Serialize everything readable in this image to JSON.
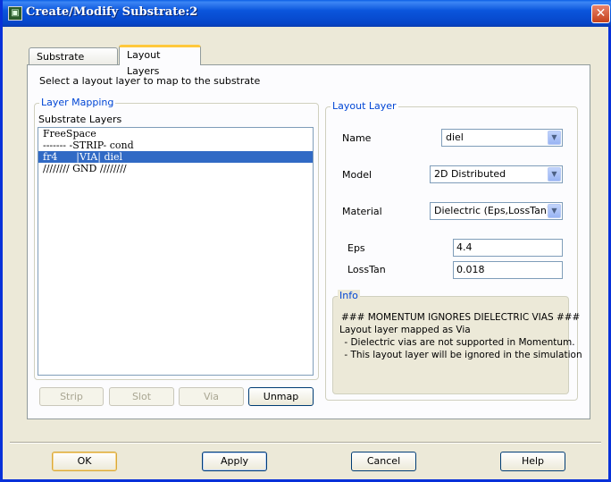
{
  "window": {
    "title": "Create/Modify Substrate:2",
    "close_glyph": "✕",
    "icon": "app-icon"
  },
  "tabs": [
    {
      "label": "Substrate Layers",
      "active": false
    },
    {
      "label": "Layout Layers",
      "active": true
    }
  ],
  "hint": "Select a layout layer to map to the substrate",
  "layer_mapping": {
    "title": "Layer Mapping",
    "list_label": "Substrate Layers",
    "items": [
      {
        "text": "FreeSpace",
        "selected": false
      },
      {
        "text": "------- -STRIP- cond",
        "selected": false
      },
      {
        "text": "fr4      |VIA| diel",
        "selected": true
      },
      {
        "text": "//////// GND ////////",
        "selected": false
      }
    ],
    "buttons": {
      "strip": "Strip",
      "slot": "Slot",
      "via": "Via",
      "unmap": "Unmap"
    }
  },
  "layout_layer": {
    "title": "Layout Layer",
    "name_label": "Name",
    "name_value": "diel",
    "model_label": "Model",
    "model_value": "2D Distributed",
    "material_label": "Material",
    "material_value": "Dielectric (Eps,LossTan)",
    "eps_label": "Eps",
    "eps_value": "4.4",
    "losstan_label": "LossTan",
    "losstan_value": "0.018"
  },
  "info": {
    "title": "Info",
    "lines": [
      "### MOMENTUM IGNORES DIELECTRIC VIAS ###",
      "Layout layer mapped as Via",
      " - Dielectric vias are not supported in Momentum.",
      " - This layout layer will be ignored in the simulation"
    ]
  },
  "footer": {
    "ok": "OK",
    "apply": "Apply",
    "cancel": "Cancel",
    "help": "Help"
  },
  "colors": {
    "title_bar": "#0a55dc",
    "selection": "#316ac5",
    "group_title": "#0046d5",
    "active_tab_accent": "#ffc83c"
  }
}
